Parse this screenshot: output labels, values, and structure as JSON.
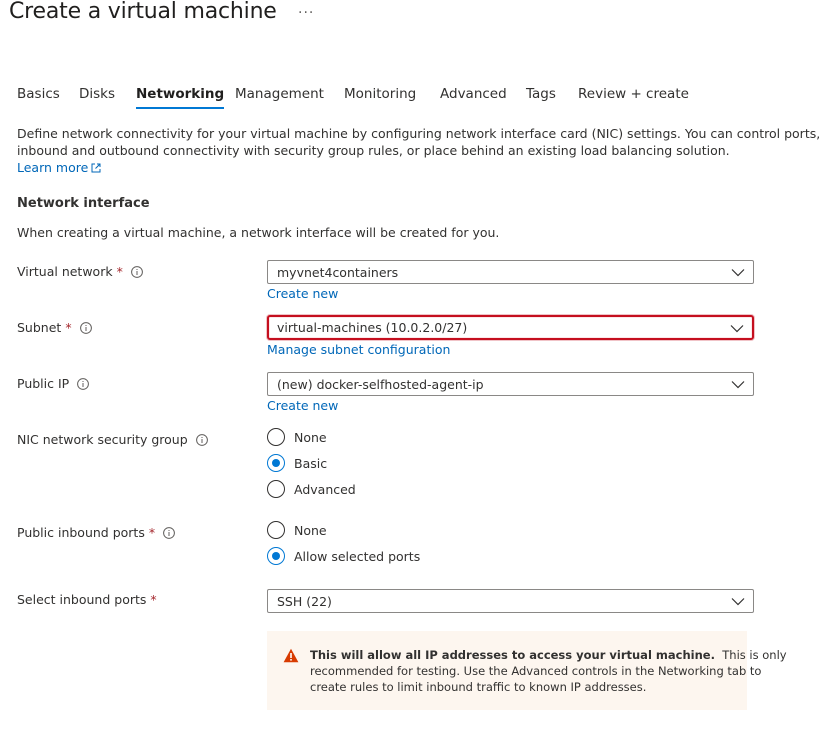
{
  "page": {
    "title": "Create a virtual machine",
    "more": "···"
  },
  "tabs": [
    {
      "label": "Basics"
    },
    {
      "label": "Disks"
    },
    {
      "label": "Networking"
    },
    {
      "label": "Management"
    },
    {
      "label": "Monitoring"
    },
    {
      "label": "Advanced"
    },
    {
      "label": "Tags"
    },
    {
      "label": "Review + create"
    }
  ],
  "intro": {
    "line1": "Define network connectivity for your virtual machine by configuring network interface card (NIC) settings. You can control ports,",
    "line2": "inbound and outbound connectivity with security group rules, or place behind an existing load balancing solution.",
    "learn_more": "Learn more"
  },
  "network_interface": {
    "title": "Network interface",
    "subtitle": "When creating a virtual machine, a network interface will be created for you."
  },
  "fields": {
    "virtual_network": {
      "label": "Virtual network",
      "required": "*",
      "value": "myvnet4containers",
      "link": "Create new"
    },
    "subnet": {
      "label": "Subnet",
      "required": "*",
      "value": "virtual-machines (10.0.2.0/27)",
      "link": "Manage subnet configuration"
    },
    "public_ip": {
      "label": "Public IP",
      "value": "(new) docker-selfhosted-agent-ip",
      "link": "Create new"
    },
    "nic_nsg": {
      "label": "NIC network security group",
      "options": [
        "None",
        "Basic",
        "Advanced"
      ],
      "selected": "Basic"
    },
    "public_inbound_ports": {
      "label": "Public inbound ports",
      "required": "*",
      "options": [
        "None",
        "Allow selected ports"
      ],
      "selected": "Allow selected ports"
    },
    "select_inbound_ports": {
      "label": "Select inbound ports",
      "required": "*",
      "value": "SSH (22)"
    }
  },
  "warning": {
    "bold": "This will allow all IP addresses to access your virtual machine.",
    "line1_rest": "This is only",
    "line2": "recommended for testing.  Use the Advanced controls in the Networking tab to",
    "line3": "create rules to limit inbound traffic to known IP addresses."
  },
  "colors": {
    "accent": "#0078d4",
    "link": "#0067b8",
    "required": "#a4262c",
    "focus_border": "#c50f1f",
    "warning_bg": "#fdf6ef",
    "warning_icon": "#d83b01"
  }
}
